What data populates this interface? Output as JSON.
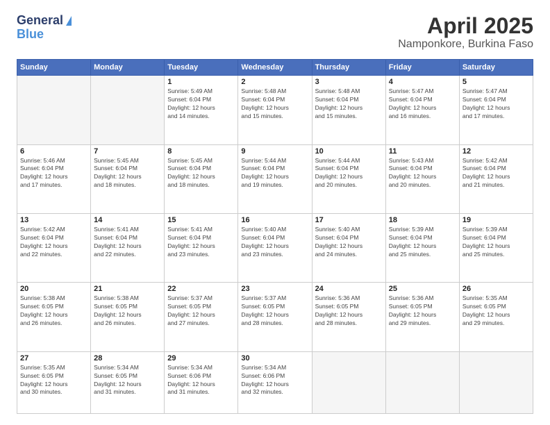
{
  "header": {
    "logo_line1": "General",
    "logo_line2": "Blue",
    "month": "April 2025",
    "location": "Namponkore, Burkina Faso"
  },
  "weekdays": [
    "Sunday",
    "Monday",
    "Tuesday",
    "Wednesday",
    "Thursday",
    "Friday",
    "Saturday"
  ],
  "days": [
    {
      "num": "",
      "info": ""
    },
    {
      "num": "",
      "info": ""
    },
    {
      "num": "1",
      "info": "Sunrise: 5:49 AM\nSunset: 6:04 PM\nDaylight: 12 hours\nand 14 minutes."
    },
    {
      "num": "2",
      "info": "Sunrise: 5:48 AM\nSunset: 6:04 PM\nDaylight: 12 hours\nand 15 minutes."
    },
    {
      "num": "3",
      "info": "Sunrise: 5:48 AM\nSunset: 6:04 PM\nDaylight: 12 hours\nand 15 minutes."
    },
    {
      "num": "4",
      "info": "Sunrise: 5:47 AM\nSunset: 6:04 PM\nDaylight: 12 hours\nand 16 minutes."
    },
    {
      "num": "5",
      "info": "Sunrise: 5:47 AM\nSunset: 6:04 PM\nDaylight: 12 hours\nand 17 minutes."
    },
    {
      "num": "6",
      "info": "Sunrise: 5:46 AM\nSunset: 6:04 PM\nDaylight: 12 hours\nand 17 minutes."
    },
    {
      "num": "7",
      "info": "Sunrise: 5:45 AM\nSunset: 6:04 PM\nDaylight: 12 hours\nand 18 minutes."
    },
    {
      "num": "8",
      "info": "Sunrise: 5:45 AM\nSunset: 6:04 PM\nDaylight: 12 hours\nand 18 minutes."
    },
    {
      "num": "9",
      "info": "Sunrise: 5:44 AM\nSunset: 6:04 PM\nDaylight: 12 hours\nand 19 minutes."
    },
    {
      "num": "10",
      "info": "Sunrise: 5:44 AM\nSunset: 6:04 PM\nDaylight: 12 hours\nand 20 minutes."
    },
    {
      "num": "11",
      "info": "Sunrise: 5:43 AM\nSunset: 6:04 PM\nDaylight: 12 hours\nand 20 minutes."
    },
    {
      "num": "12",
      "info": "Sunrise: 5:42 AM\nSunset: 6:04 PM\nDaylight: 12 hours\nand 21 minutes."
    },
    {
      "num": "13",
      "info": "Sunrise: 5:42 AM\nSunset: 6:04 PM\nDaylight: 12 hours\nand 22 minutes."
    },
    {
      "num": "14",
      "info": "Sunrise: 5:41 AM\nSunset: 6:04 PM\nDaylight: 12 hours\nand 22 minutes."
    },
    {
      "num": "15",
      "info": "Sunrise: 5:41 AM\nSunset: 6:04 PM\nDaylight: 12 hours\nand 23 minutes."
    },
    {
      "num": "16",
      "info": "Sunrise: 5:40 AM\nSunset: 6:04 PM\nDaylight: 12 hours\nand 23 minutes."
    },
    {
      "num": "17",
      "info": "Sunrise: 5:40 AM\nSunset: 6:04 PM\nDaylight: 12 hours\nand 24 minutes."
    },
    {
      "num": "18",
      "info": "Sunrise: 5:39 AM\nSunset: 6:04 PM\nDaylight: 12 hours\nand 25 minutes."
    },
    {
      "num": "19",
      "info": "Sunrise: 5:39 AM\nSunset: 6:04 PM\nDaylight: 12 hours\nand 25 minutes."
    },
    {
      "num": "20",
      "info": "Sunrise: 5:38 AM\nSunset: 6:05 PM\nDaylight: 12 hours\nand 26 minutes."
    },
    {
      "num": "21",
      "info": "Sunrise: 5:38 AM\nSunset: 6:05 PM\nDaylight: 12 hours\nand 26 minutes."
    },
    {
      "num": "22",
      "info": "Sunrise: 5:37 AM\nSunset: 6:05 PM\nDaylight: 12 hours\nand 27 minutes."
    },
    {
      "num": "23",
      "info": "Sunrise: 5:37 AM\nSunset: 6:05 PM\nDaylight: 12 hours\nand 28 minutes."
    },
    {
      "num": "24",
      "info": "Sunrise: 5:36 AM\nSunset: 6:05 PM\nDaylight: 12 hours\nand 28 minutes."
    },
    {
      "num": "25",
      "info": "Sunrise: 5:36 AM\nSunset: 6:05 PM\nDaylight: 12 hours\nand 29 minutes."
    },
    {
      "num": "26",
      "info": "Sunrise: 5:35 AM\nSunset: 6:05 PM\nDaylight: 12 hours\nand 29 minutes."
    },
    {
      "num": "27",
      "info": "Sunrise: 5:35 AM\nSunset: 6:05 PM\nDaylight: 12 hours\nand 30 minutes."
    },
    {
      "num": "28",
      "info": "Sunrise: 5:34 AM\nSunset: 6:05 PM\nDaylight: 12 hours\nand 31 minutes."
    },
    {
      "num": "29",
      "info": "Sunrise: 5:34 AM\nSunset: 6:06 PM\nDaylight: 12 hours\nand 31 minutes."
    },
    {
      "num": "30",
      "info": "Sunrise: 5:34 AM\nSunset: 6:06 PM\nDaylight: 12 hours\nand 32 minutes."
    },
    {
      "num": "",
      "info": ""
    },
    {
      "num": "",
      "info": ""
    },
    {
      "num": "",
      "info": ""
    }
  ]
}
